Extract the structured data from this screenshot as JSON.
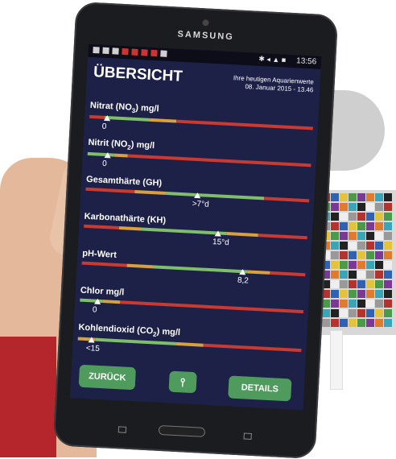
{
  "device": {
    "brand": "SAMSUNG"
  },
  "status_bar": {
    "time": "13:56",
    "signal": "✱ ◂ ▲ ■"
  },
  "app": {
    "title": "ÜBERSICHT",
    "subtitle_line1": "Ihre heutigen Aquarienwerte",
    "subtitle_line2": "08. Januar 2015 - 13.46",
    "parameters": [
      {
        "label": "Nitrat (NO",
        "sub": "3",
        "suffix": ") mg/l",
        "value": "0",
        "marker_pos": 0.08,
        "segments": [
          {
            "w": 0.07,
            "c": "#c93a33"
          },
          {
            "w": 0.2,
            "c": "#7fbf6a"
          },
          {
            "w": 0.12,
            "c": "#d9a040"
          },
          {
            "w": 0.61,
            "c": "#c93a33"
          }
        ]
      },
      {
        "label": "Nitrit (NO",
        "sub": "2",
        "suffix": ") mg/l",
        "value": "0",
        "marker_pos": 0.09,
        "segments": [
          {
            "w": 0.12,
            "c": "#7fbf6a"
          },
          {
            "w": 0.06,
            "c": "#d9a040"
          },
          {
            "w": 0.82,
            "c": "#c93a33"
          }
        ]
      },
      {
        "label": "Gesamthärte (GH)",
        "sub": "",
        "suffix": "",
        "value": ">7°d",
        "marker_pos": 0.5,
        "segments": [
          {
            "w": 0.22,
            "c": "#c93a33"
          },
          {
            "w": 0.14,
            "c": "#d9a040"
          },
          {
            "w": 0.44,
            "c": "#7fbf6a"
          },
          {
            "w": 0.2,
            "c": "#c93a33"
          }
        ]
      },
      {
        "label": "Karbonathärte (KH)",
        "sub": "",
        "suffix": "",
        "value": "15°d",
        "marker_pos": 0.6,
        "segments": [
          {
            "w": 0.16,
            "c": "#c93a33"
          },
          {
            "w": 0.1,
            "c": "#d9a040"
          },
          {
            "w": 0.38,
            "c": "#7fbf6a"
          },
          {
            "w": 0.14,
            "c": "#d9a040"
          },
          {
            "w": 0.22,
            "c": "#c93a33"
          }
        ]
      },
      {
        "label": "pH-Wert",
        "sub": "",
        "suffix": "",
        "value": "8,2",
        "marker_pos": 0.72,
        "segments": [
          {
            "w": 0.2,
            "c": "#c93a33"
          },
          {
            "w": 0.12,
            "c": "#d9a040"
          },
          {
            "w": 0.42,
            "c": "#7fbf6a"
          },
          {
            "w": 0.1,
            "c": "#d9a040"
          },
          {
            "w": 0.16,
            "c": "#c93a33"
          }
        ]
      },
      {
        "label": "Chlor mg/l",
        "sub": "",
        "suffix": "",
        "value": "0",
        "marker_pos": 0.08,
        "segments": [
          {
            "w": 0.1,
            "c": "#7fbf6a"
          },
          {
            "w": 0.08,
            "c": "#d9a040"
          },
          {
            "w": 0.82,
            "c": "#c93a33"
          }
        ]
      },
      {
        "label": "Kohlendioxid (CO",
        "sub": "2",
        "suffix": ") mg/l",
        "value": "<15",
        "marker_pos": 0.06,
        "segments": [
          {
            "w": 0.08,
            "c": "#d9a040"
          },
          {
            "w": 0.36,
            "c": "#7fbf6a"
          },
          {
            "w": 0.12,
            "c": "#d9a040"
          },
          {
            "w": 0.44,
            "c": "#c93a33"
          }
        ]
      }
    ],
    "buttons": {
      "back": "ZURÜCK",
      "details": "DETAILS",
      "share_icon": "share-icon"
    }
  }
}
